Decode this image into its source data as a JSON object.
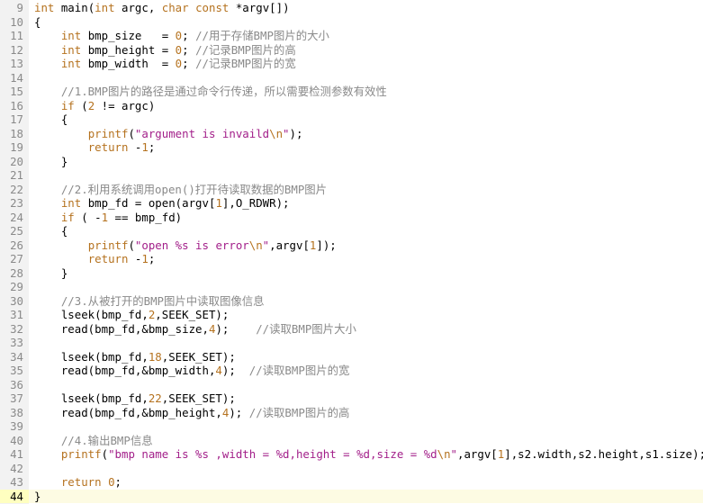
{
  "editor": {
    "colors": {
      "keyword": "#b5721f",
      "string": "#a3208a",
      "comment": "#8a8a8a",
      "text": "#000000",
      "gutter_bg": "#f2f2f2",
      "current_line": "#ffffc0"
    },
    "current_line": 44,
    "lines": [
      {
        "n": "9",
        "tokens": [
          [
            "kw",
            "int"
          ],
          [
            "t",
            " main("
          ],
          [
            "kw",
            "int"
          ],
          [
            "t",
            " argc, "
          ],
          [
            "kw",
            "char"
          ],
          [
            "t",
            " "
          ],
          [
            "kw",
            "const"
          ],
          [
            "t",
            " *argv[])"
          ]
        ]
      },
      {
        "n": "10",
        "tokens": [
          [
            "t",
            "{"
          ]
        ]
      },
      {
        "n": "11",
        "tokens": [
          [
            "t",
            "    "
          ],
          [
            "kw",
            "int"
          ],
          [
            "t",
            " bmp_size   = "
          ],
          [
            "num",
            "0"
          ],
          [
            "t",
            "; "
          ],
          [
            "cmt",
            "//用于存储BMP图片的大小"
          ]
        ]
      },
      {
        "n": "12",
        "tokens": [
          [
            "t",
            "    "
          ],
          [
            "kw",
            "int"
          ],
          [
            "t",
            " bmp_height = "
          ],
          [
            "num",
            "0"
          ],
          [
            "t",
            "; "
          ],
          [
            "cmt",
            "//记录BMP图片的高"
          ]
        ]
      },
      {
        "n": "13",
        "tokens": [
          [
            "t",
            "    "
          ],
          [
            "kw",
            "int"
          ],
          [
            "t",
            " bmp_width  = "
          ],
          [
            "num",
            "0"
          ],
          [
            "t",
            "; "
          ],
          [
            "cmt",
            "//记录BMP图片的宽"
          ]
        ]
      },
      {
        "n": "14",
        "tokens": []
      },
      {
        "n": "15",
        "tokens": [
          [
            "t",
            "    "
          ],
          [
            "cmt",
            "//1.BMP图片的路径是通过命令行传递，所以需要检测参数有效性"
          ]
        ]
      },
      {
        "n": "16",
        "tokens": [
          [
            "t",
            "    "
          ],
          [
            "kw",
            "if"
          ],
          [
            "t",
            " ("
          ],
          [
            "num",
            "2"
          ],
          [
            "t",
            " != argc)"
          ]
        ]
      },
      {
        "n": "17",
        "tokens": [
          [
            "t",
            "    {"
          ]
        ]
      },
      {
        "n": "18",
        "tokens": [
          [
            "t",
            "        "
          ],
          [
            "kw",
            "printf"
          ],
          [
            "t",
            "("
          ],
          [
            "str",
            "\"argument is invaild"
          ],
          [
            "esc",
            "\\n"
          ],
          [
            "str",
            "\""
          ],
          [
            "t",
            ");"
          ]
        ]
      },
      {
        "n": "19",
        "tokens": [
          [
            "t",
            "        "
          ],
          [
            "kw",
            "return"
          ],
          [
            "t",
            " -"
          ],
          [
            "num",
            "1"
          ],
          [
            "t",
            ";"
          ]
        ]
      },
      {
        "n": "20",
        "tokens": [
          [
            "t",
            "    }"
          ]
        ]
      },
      {
        "n": "21",
        "tokens": []
      },
      {
        "n": "22",
        "tokens": [
          [
            "t",
            "    "
          ],
          [
            "cmt",
            "//2.利用系统调用open()打开待读取数据的BMP图片"
          ]
        ]
      },
      {
        "n": "23",
        "tokens": [
          [
            "t",
            "    "
          ],
          [
            "kw",
            "int"
          ],
          [
            "t",
            " bmp_fd = open(argv["
          ],
          [
            "num",
            "1"
          ],
          [
            "t",
            "],O_RDWR);"
          ]
        ]
      },
      {
        "n": "24",
        "tokens": [
          [
            "t",
            "    "
          ],
          [
            "kw",
            "if"
          ],
          [
            "t",
            " ( -"
          ],
          [
            "num",
            "1"
          ],
          [
            "t",
            " == bmp_fd)"
          ]
        ]
      },
      {
        "n": "25",
        "tokens": [
          [
            "t",
            "    {"
          ]
        ]
      },
      {
        "n": "26",
        "tokens": [
          [
            "t",
            "        "
          ],
          [
            "kw",
            "printf"
          ],
          [
            "t",
            "("
          ],
          [
            "str",
            "\"open %s is error"
          ],
          [
            "esc",
            "\\n"
          ],
          [
            "str",
            "\""
          ],
          [
            "t",
            ",argv["
          ],
          [
            "num",
            "1"
          ],
          [
            "t",
            "]);"
          ]
        ]
      },
      {
        "n": "27",
        "tokens": [
          [
            "t",
            "        "
          ],
          [
            "kw",
            "return"
          ],
          [
            "t",
            " -"
          ],
          [
            "num",
            "1"
          ],
          [
            "t",
            ";"
          ]
        ]
      },
      {
        "n": "28",
        "tokens": [
          [
            "t",
            "    }"
          ]
        ]
      },
      {
        "n": "29",
        "tokens": []
      },
      {
        "n": "30",
        "tokens": [
          [
            "t",
            "    "
          ],
          [
            "cmt",
            "//3.从被打开的BMP图片中读取图像信息"
          ]
        ]
      },
      {
        "n": "31",
        "tokens": [
          [
            "t",
            "    lseek(bmp_fd,"
          ],
          [
            "num",
            "2"
          ],
          [
            "t",
            ",SEEK_SET);"
          ]
        ]
      },
      {
        "n": "32",
        "tokens": [
          [
            "t",
            "    read(bmp_fd,&bmp_size,"
          ],
          [
            "num",
            "4"
          ],
          [
            "t",
            ");    "
          ],
          [
            "cmt",
            "//读取BMP图片大小"
          ]
        ]
      },
      {
        "n": "33",
        "tokens": []
      },
      {
        "n": "34",
        "tokens": [
          [
            "t",
            "    lseek(bmp_fd,"
          ],
          [
            "num",
            "18"
          ],
          [
            "t",
            ",SEEK_SET);"
          ]
        ]
      },
      {
        "n": "35",
        "tokens": [
          [
            "t",
            "    read(bmp_fd,&bmp_width,"
          ],
          [
            "num",
            "4"
          ],
          [
            "t",
            ");  "
          ],
          [
            "cmt",
            "//读取BMP图片的宽"
          ]
        ]
      },
      {
        "n": "36",
        "tokens": []
      },
      {
        "n": "37",
        "tokens": [
          [
            "t",
            "    lseek(bmp_fd,"
          ],
          [
            "num",
            "22"
          ],
          [
            "t",
            ",SEEK_SET);"
          ]
        ]
      },
      {
        "n": "38",
        "tokens": [
          [
            "t",
            "    read(bmp_fd,&bmp_height,"
          ],
          [
            "num",
            "4"
          ],
          [
            "t",
            "); "
          ],
          [
            "cmt",
            "//读取BMP图片的高"
          ]
        ]
      },
      {
        "n": "39",
        "tokens": []
      },
      {
        "n": "40",
        "tokens": [
          [
            "t",
            "    "
          ],
          [
            "cmt",
            "//4.输出BMP信息"
          ]
        ]
      },
      {
        "n": "41",
        "tokens": [
          [
            "t",
            "    "
          ],
          [
            "kw",
            "printf"
          ],
          [
            "t",
            "("
          ],
          [
            "str",
            "\"bmp name is %s ,width = %d,height = %d,size = %d"
          ],
          [
            "esc",
            "\\n"
          ],
          [
            "str",
            "\""
          ],
          [
            "t",
            ",argv["
          ],
          [
            "num",
            "1"
          ],
          [
            "t",
            "],s2.width,s2.height,s1.size);"
          ]
        ]
      },
      {
        "n": "42",
        "tokens": []
      },
      {
        "n": "43",
        "tokens": [
          [
            "t",
            "    "
          ],
          [
            "kw",
            "return"
          ],
          [
            "t",
            " "
          ],
          [
            "num",
            "0"
          ],
          [
            "t",
            ";"
          ]
        ]
      },
      {
        "n": "44",
        "tokens": [
          [
            "t",
            "}"
          ]
        ]
      }
    ]
  }
}
